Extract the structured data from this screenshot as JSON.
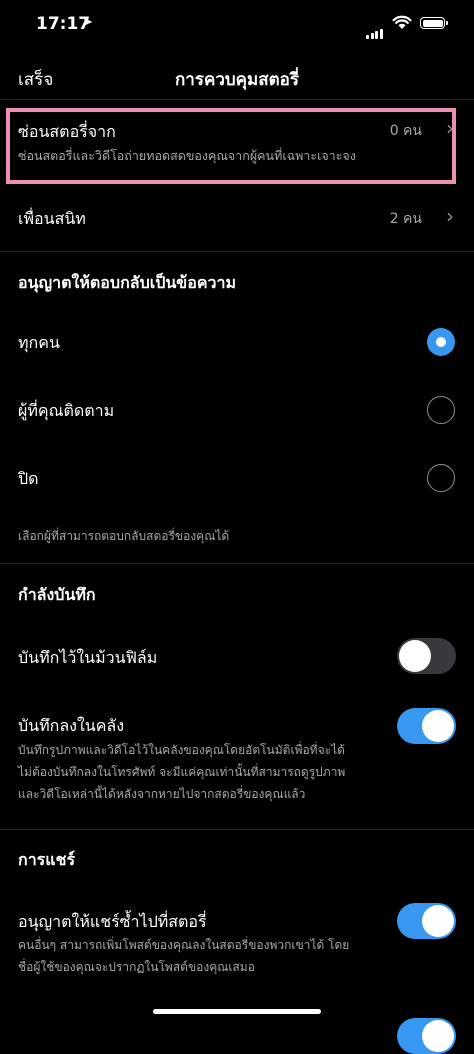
{
  "status_bar": {
    "time": "17:17"
  },
  "nav": {
    "done": "เสร็จ",
    "title": "การควบคุมสตอรี่"
  },
  "hide_story": {
    "label": "ซ่อนสตอรี่จาก",
    "value": "0 คน",
    "description": "ซ่อนสตอรี่และวิดีโอถ่ายทอดสดของคุณจากผู้คนที่เฉพาะเจาะจง"
  },
  "close_friends": {
    "label": "เพื่อนสนิท",
    "value": "2 คน"
  },
  "replies": {
    "header": "อนุญาตให้ตอบกลับเป็นข้อความ",
    "options": [
      {
        "label": "ทุกคน",
        "selected": true
      },
      {
        "label": "ผู้ที่คุณติดตาม",
        "selected": false
      },
      {
        "label": "ปิด",
        "selected": false
      }
    ],
    "footnote": "เลือกผู้ที่สามารถตอบกลับสตอรี่ของคุณได้"
  },
  "saving": {
    "header": "กำลังบันทึก",
    "camera_roll": {
      "label": "บันทึกไว้ในม้วนฟิล์ม",
      "on": false
    },
    "archive": {
      "label": "บันทึกลงในคลัง",
      "on": true,
      "description": [
        "บันทึกรูปภาพและวิดีโอไว้ในคลังของคุณโดยอัตโนมัติเพื่อที่จะได้",
        "ไม่ต้องบันทึกลงในโทรศัพท์ จะมีแค่คุณเท่านั้นที่สามารถดูรูปภาพ",
        "และวิดีโอเหล่านี้ได้หลังจากหายไปจากสตอรี่ของคุณแล้ว"
      ]
    }
  },
  "sharing": {
    "header": "การแชร์",
    "reshare": {
      "label": "อนุญาตให้แชร์ซ้ำไปที่สตอรี่",
      "on": true,
      "description": [
        "คนอื่นๆ สามารถเพิ่มโพสต์ของคุณลงในสตอรี่ของพวกเขาได้ โดย",
        "ชื่อผู้ใช้ของคุณจะปรากฏในโพสต์ของคุณเสมอ"
      ]
    }
  },
  "colors": {
    "accent": "#3897f0",
    "highlight": "#ec8fb4",
    "secondary_text": "#a8a8a8"
  }
}
